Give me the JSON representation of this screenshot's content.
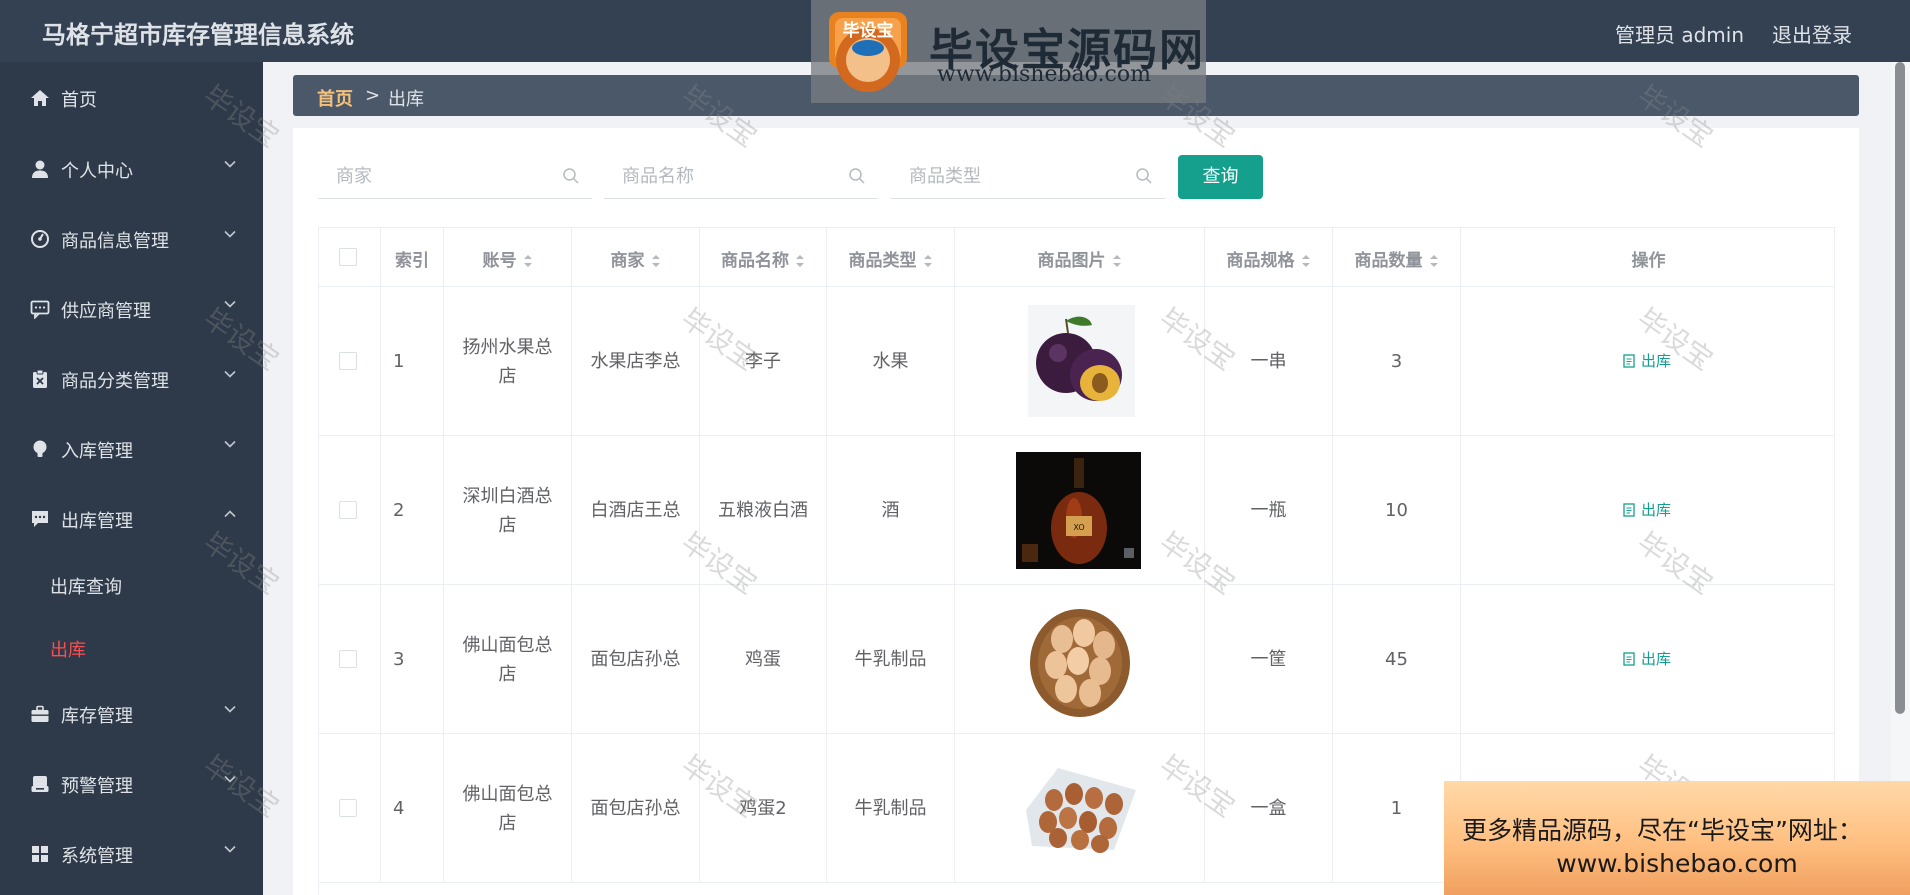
{
  "header": {
    "app_title": "马格宁超市库存管理信息系统",
    "user_label": "管理员 admin",
    "logout_label": "退出登录"
  },
  "sidebar": {
    "items": [
      {
        "label": "首页",
        "icon": "home-icon"
      },
      {
        "label": "个人中心",
        "icon": "user-icon"
      },
      {
        "label": "商品信息管理",
        "icon": "dashboard-icon"
      },
      {
        "label": "供应商管理",
        "icon": "chat-icon"
      },
      {
        "label": "商品分类管理",
        "icon": "clipboard-icon"
      },
      {
        "label": "入库管理",
        "icon": "bulb-icon"
      },
      {
        "label": "出库管理",
        "icon": "message-icon",
        "expanded": true
      },
      {
        "label": "库存管理",
        "icon": "briefcase-icon"
      },
      {
        "label": "预警管理",
        "icon": "tray-icon"
      },
      {
        "label": "系统管理",
        "icon": "grid-icon"
      }
    ],
    "sub_items": [
      {
        "label": "出库查询",
        "active": false
      },
      {
        "label": "出库",
        "active": true
      }
    ]
  },
  "breadcrumb": {
    "home": "首页",
    "separator": ">",
    "current": "出库"
  },
  "search": {
    "merchant_placeholder": "商家",
    "product_name_placeholder": "商品名称",
    "product_type_placeholder": "商品类型",
    "query_label": "查询"
  },
  "table": {
    "headers": {
      "index": "索引",
      "account": "账号",
      "merchant": "商家",
      "product_name": "商品名称",
      "product_type": "商品类型",
      "product_image": "商品图片",
      "spec": "商品规格",
      "quantity": "商品数量",
      "actions": "操作"
    },
    "rows": [
      {
        "index": "1",
        "account": "扬州水果总店",
        "merchant": "水果店李总",
        "product_name": "李子",
        "product_type": "水果",
        "image": "plum-image",
        "spec": "一串",
        "quantity": "3",
        "action": "出库"
      },
      {
        "index": "2",
        "account": "深圳白酒总店",
        "merchant": "白酒店王总",
        "product_name": "五粮液白酒",
        "product_type": "酒",
        "image": "liquor-bottle-image",
        "spec": "一瓶",
        "quantity": "10",
        "action": "出库"
      },
      {
        "index": "3",
        "account": "佛山面包总店",
        "merchant": "面包店孙总",
        "product_name": "鸡蛋",
        "product_type": "牛乳制品",
        "image": "egg-basket-image",
        "spec": "一筐",
        "quantity": "45",
        "action": "出库"
      },
      {
        "index": "4",
        "account": "佛山面包总店",
        "merchant": "面包店孙总",
        "product_name": "鸡蛋2",
        "product_type": "牛乳制品",
        "image": "egg-carton-image",
        "spec": "一盒",
        "quantity": "1",
        "action": ""
      }
    ]
  },
  "watermark": {
    "text": "毕设宝"
  },
  "logo_overlay": {
    "badge_text": "毕设宝",
    "title": "毕设宝源码网",
    "url": "www.bishebao.com"
  },
  "promo": {
    "line1": "更多精品源码，尽在“毕设宝”网址：",
    "line2": "www.bishebao.com"
  },
  "colors": {
    "header_bg": "#334152",
    "sidebar_bg": "#2e3a49",
    "breadcrumb_bg": "#4a5869",
    "accent": "#14a08c",
    "active_menu": "#ff4d4f",
    "breadcrumb_home": "#f5c17a"
  }
}
